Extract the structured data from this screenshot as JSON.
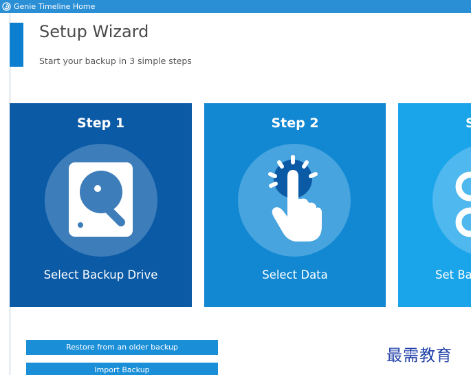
{
  "window": {
    "title": "Genie Timeline Home",
    "icon": "genie-spiral-icon",
    "titlebar_color": "#2b8fd6"
  },
  "header": {
    "title": "Setup Wizard",
    "subtitle": "Start your backup in 3 simple steps",
    "accent_color": "#0d7fd1"
  },
  "steps": [
    {
      "step_label": "Step 1",
      "action_label": "Select Backup Drive",
      "icon": "hard-drive-icon",
      "color": "#0b5aa6"
    },
    {
      "step_label": "Step 2",
      "action_label": "Select Data",
      "icon": "tap-hand-icon",
      "color": "#1288d3"
    },
    {
      "step_label": "S",
      "action_label": "Set Bac",
      "icon": "gears-icon",
      "color": "#1aa4ea"
    }
  ],
  "buttons": {
    "restore": "Restore from an older backup",
    "import": "Import Backup"
  },
  "watermark": "最需教育"
}
